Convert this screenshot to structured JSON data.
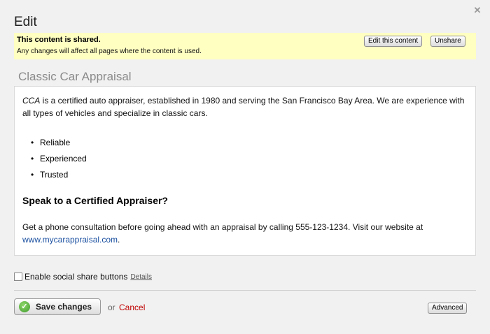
{
  "dialog": {
    "title": "Edit",
    "close_icon": "close-icon"
  },
  "banner": {
    "title": "This content is shared.",
    "subtitle": "Any changes will affect all pages where the content is used.",
    "edit_label": "Edit this content",
    "unshare_label": "Unshare"
  },
  "content": {
    "title": "Classic Car Appraisal",
    "intro_em": "CCA",
    "intro_rest": " is a certified auto appraiser, established in 1980 and serving the San Francisco Bay Area. We are experience with all types of vehicles and specialize in classic cars.",
    "bullets": [
      "Reliable",
      "Experienced",
      "Trusted"
    ],
    "heading": "Speak to a Certified Appraiser?",
    "cta_text": "Get a phone consultation before going ahead with an appraisal by calling 555-123-1234. Visit our website at ",
    "cta_link": "www.mycarappraisal.com",
    "cta_end": "."
  },
  "social": {
    "label": "Enable social share buttons",
    "details_label": "Details",
    "checked": false
  },
  "footer": {
    "save_label": "Save changes",
    "or_label": "or",
    "cancel_label": "Cancel",
    "advanced_label": "Advanced"
  },
  "colors": {
    "banner_bg": "#ffffc2",
    "cancel": "#c00000",
    "link": "#1a4fa0",
    "save_check": "#4caf33"
  }
}
